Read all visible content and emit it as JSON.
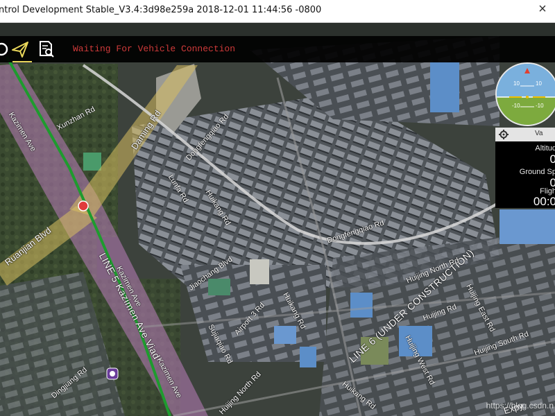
{
  "window": {
    "title": "ntrol Development Stable_V3.4:3d98e259a 2018-12-01 11:44:56 -0800",
    "close_glyph": "×"
  },
  "toolbar": {
    "status": "Waiting For Vehicle Connection",
    "icons": [
      "gear-icon",
      "plan-icon",
      "analyze-icon"
    ],
    "status_color": "#d03a3a"
  },
  "attitude": {
    "pitch_labels": [
      "10",
      "10",
      "-10",
      "-10"
    ]
  },
  "instrument": {
    "header": "Va",
    "rows": [
      {
        "label": "Altitud",
        "value": "0"
      },
      {
        "label": "Ground Sp",
        "value": "0"
      },
      {
        "label": "Fligh",
        "value": "00:0"
      }
    ]
  },
  "map": {
    "labels": {
      "kazimen_ave": "Kazimen Ave",
      "xunzhan_rd": "Xunzhan Rd",
      "daming_rd": "Daming Rd",
      "dongfengqiao_rd_1": "Dongfengqiao Rd",
      "lunfa_rd": "Lunfa Rd",
      "huikang_rd_1": "Huikang Rd",
      "dongfengqiao_rd_2": "Dongfengqiao Rd",
      "ruanjian_blvd": "Ruanjian Blvd",
      "line_kazimen": "LINE 5 Kazimen Ave Viad",
      "kazimen_ave_2": "Kazimen Ave",
      "kazimen_ave_3": "Kazimen Ave",
      "jiaochang_blvd": "Jiaochang Blvd",
      "airport_3_rd": "Airport 3 Rd",
      "huikang_rd_2": "Huikang Rd",
      "line6": "LINE 6 (UNDER CONSTRUCTION)",
      "huijing_north_rd": "Huijing North Rd",
      "huijing_rd": "Huijing Rd",
      "huijing_west_rd": "Huijing West Rd",
      "huijing_east_rd": "Huijing East Rd",
      "huijing_south_rd": "Huijing South Rd",
      "sujiaqiao_rd": "Sujiaqiao Rd",
      "huijing_north_rd_2": "Huijing North Rd",
      "huikang_rd_3": "Huikang Rd",
      "dingjiang_rd": "Dingjiang Rd",
      "expy": "Expy"
    }
  },
  "watermark": "https://blog.csdn.n"
}
